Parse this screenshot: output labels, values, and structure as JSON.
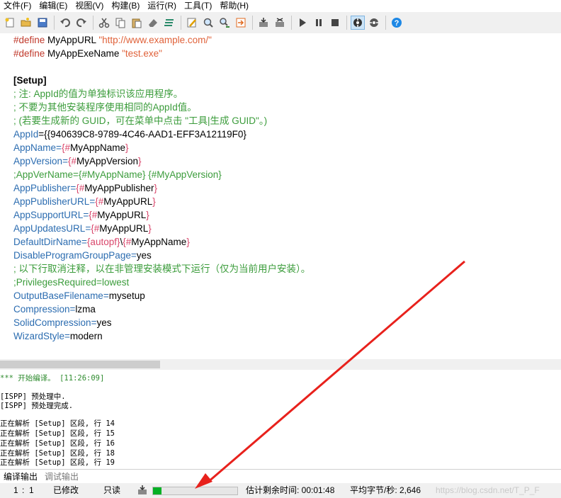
{
  "menu": [
    "文件(F)",
    "编辑(E)",
    "视图(V)",
    "构建(B)",
    "运行(R)",
    "工具(T)",
    "帮助(H)"
  ],
  "toolbar": {
    "icons": [
      "new-file-icon",
      "open-file-icon",
      "save-icon",
      "undo-icon",
      "redo-icon",
      "cut-icon",
      "copy-icon",
      "paste-icon",
      "eraser-icon",
      "select-all-icon",
      "edit-icon",
      "find-icon",
      "find-replace-icon",
      "goto-icon",
      "compile-icon",
      "stop-compile-icon",
      "run-icon",
      "pause-icon",
      "stop-icon",
      "debug-icon",
      "target-icon",
      "help-icon"
    ]
  },
  "editor": {
    "line1": {
      "pre": "#define",
      "name": " MyAppURL ",
      "val": "\"http://www.example.com/\""
    },
    "line2": {
      "pre": "#define",
      "name": " MyAppExeName ",
      "val": "\"test.exe\""
    },
    "section": "[Setup]",
    "c1": "; 注: AppId的值为单独标识该应用程序。",
    "c2": "; 不要为其他安装程序使用相同的AppId值。",
    "c3": "; (若要生成新的 GUID，可在菜单中点击 \"工具|生成 GUID\"。)",
    "appid_key": "AppId",
    "appid_val": "={{940639C8-9789-4C46-AAD1-EFF3A12119F0}",
    "appname_key": "AppName",
    "appname_val": "MyAppName",
    "appversion_key": "AppVersion",
    "appversion_val": "MyAppVersion",
    "appvername_line": ";AppVerName={#MyAppName} {#MyAppVersion}",
    "publisher_key": "AppPublisher",
    "publisher_val": "MyAppPublisher",
    "publisherurl_key": "AppPublisherURL",
    "publisherurl_val": "MyAppURL",
    "supporturl_key": "AppSupportURL",
    "supporturl_val": "MyAppURL",
    "updatesurl_key": "AppUpdatesURL",
    "updatesurl_val": "MyAppURL",
    "defaultdir_key": "DefaultDirName",
    "defaultdir_const": "{autopf}",
    "defaultdir_val": "MyAppName",
    "disablegroup_key": "DisableProgramGroupPage",
    "disablegroup_val": "yes",
    "c4": "; 以下行取消注释，以在非管理安装模式下运行（仅为当前用户安装）。",
    "privileges_line": ";PrivilegesRequired=lowest",
    "outbase_key": "OutputBaseFilename",
    "outbase_val": "mysetup",
    "compression_key": "Compression",
    "compression_val": "lzma",
    "solid_key": "SolidCompression",
    "solid_val": "yes",
    "wizard_key": "WizardStyle",
    "wizard_val": "modern"
  },
  "output": {
    "start": "*** 开始编译。 [11:26:09]",
    "ispp1": "[ISPP] 预处理中.",
    "ispp2": "[ISPP] 预处理完成.",
    "parse": [
      "正在解析 [Setup] 区段, 行 14",
      "正在解析 [Setup] 区段, 行 15",
      "正在解析 [Setup] 区段, 行 16",
      "正在解析 [Setup] 区段, 行 18",
      "正在解析 [Setup] 区段, 行 19"
    ]
  },
  "tabs": {
    "compile": "编译输出",
    "debug": "调试输出"
  },
  "status": {
    "line": "1",
    "col": "1",
    "modified": "已修改",
    "readonly": "只读",
    "progress": 0.1,
    "remaining": "估计剩余时间: 00:01:48",
    "rate": "平均字节/秒: 2,646",
    "watermark": "https://blog.csdn.net/T_P_F"
  },
  "colors": {
    "progress": "#06b025",
    "annotation_arrow": "#e8211c"
  }
}
